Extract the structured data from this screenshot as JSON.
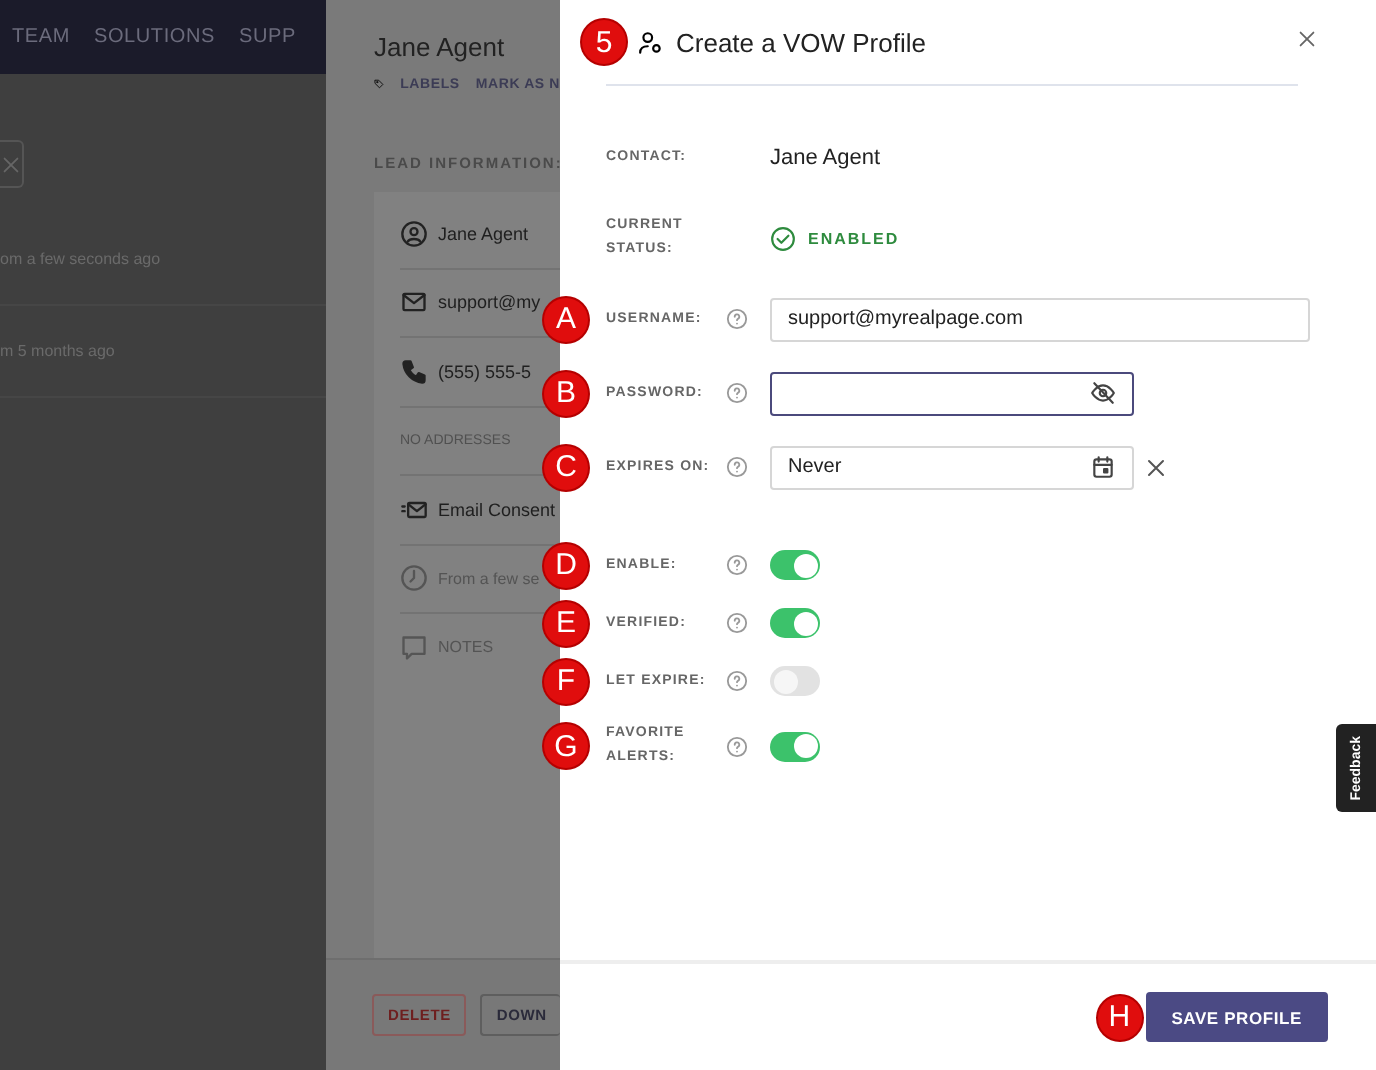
{
  "nav": {
    "items": [
      "TEAM",
      "SOLUTIONS",
      "SUPP"
    ]
  },
  "activity": [
    "om a few seconds ago",
    "m 5 months ago"
  ],
  "lead": {
    "name": "Jane Agent",
    "actions": [
      "LABELS",
      "MARK AS N"
    ],
    "section": "LEAD INFORMATION:",
    "rows": [
      {
        "kind": "contact",
        "text": "Jane Agent"
      },
      {
        "kind": "email",
        "text": "support@my"
      },
      {
        "kind": "phone",
        "text": "(555) 555-5"
      },
      {
        "kind": "address",
        "text": "NO ADDRESSES"
      },
      {
        "kind": "consent",
        "text": "Email Consent"
      },
      {
        "kind": "time",
        "text": "From a few se"
      },
      {
        "kind": "notes",
        "text": "NOTES"
      }
    ],
    "buttons": [
      {
        "kind": "danger",
        "label": "DELETE"
      },
      {
        "kind": "default",
        "label": "DOWN"
      }
    ]
  },
  "dialog": {
    "marker": "5",
    "title": "Create a VOW Profile",
    "contact": {
      "label": "CONTACT:",
      "value": "Jane Agent"
    },
    "status": {
      "label": "CURRENT STATUS:",
      "value": "ENABLED",
      "enabled": true
    },
    "fields": [
      {
        "marker": "A",
        "label": "USERNAME:",
        "kind": "text",
        "value": "support@myrealpage.com",
        "focused": false
      },
      {
        "marker": "B",
        "label": "PASSWORD:",
        "kind": "password",
        "focused": true
      },
      {
        "marker": "C",
        "label": "EXPIRES ON:",
        "kind": "date",
        "value": "Never",
        "focused": false
      }
    ],
    "toggles": [
      {
        "marker": "D",
        "label": "ENABLE:",
        "on": true
      },
      {
        "marker": "E",
        "label": "VERIFIED:",
        "on": true
      },
      {
        "marker": "F",
        "label": "LET EXPIRE:",
        "on": false
      },
      {
        "marker": "G",
        "label": "FAVORITE ALERTS:",
        "on": true
      }
    ],
    "save": {
      "marker": "H",
      "label": "SAVE PROFILE"
    }
  },
  "feedback_tab": "Feedback"
}
